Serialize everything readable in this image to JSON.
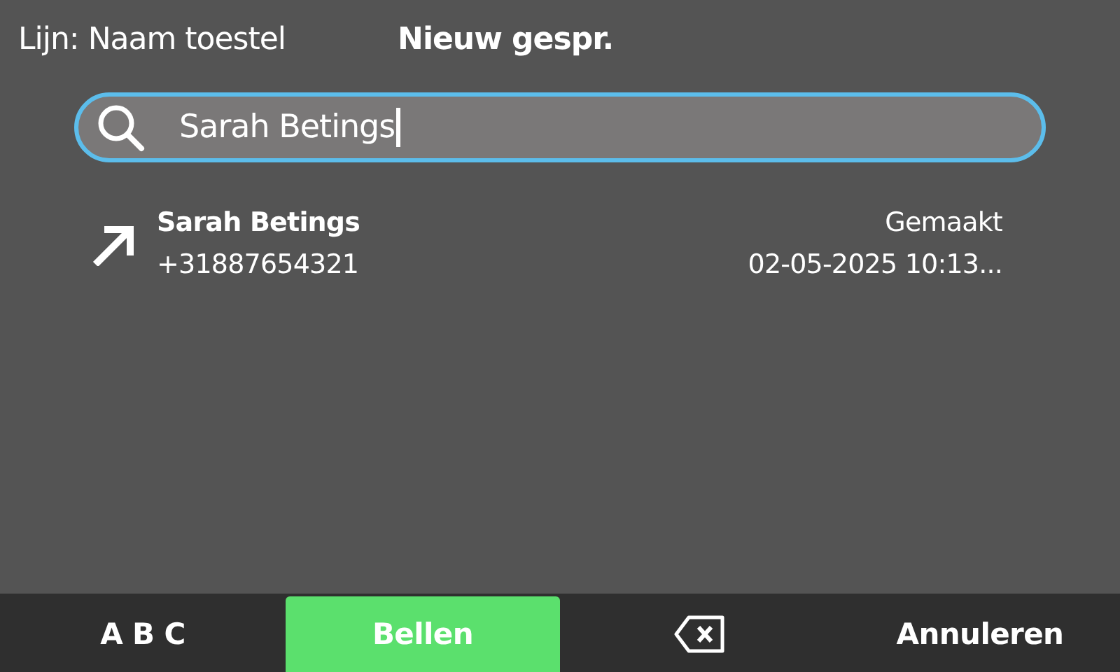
{
  "header": {
    "line_label": "Lijn: Naam toestel",
    "title": "Nieuw gespr."
  },
  "search": {
    "value": "Sarah Betings",
    "focused": true
  },
  "results": [
    {
      "name": "Sarah Betings",
      "number": "+31887654321",
      "kind": "outgoing",
      "status": "Gemaakt",
      "time": "02-05-2025 10:13..."
    }
  ],
  "softkeys": [
    {
      "kind": "text",
      "label": "A B C",
      "primary": false
    },
    {
      "kind": "text",
      "label": "Bellen",
      "primary": true
    },
    {
      "kind": "backspace",
      "primary": false
    },
    {
      "kind": "text",
      "label": "Annuleren",
      "primary": false
    }
  ]
}
